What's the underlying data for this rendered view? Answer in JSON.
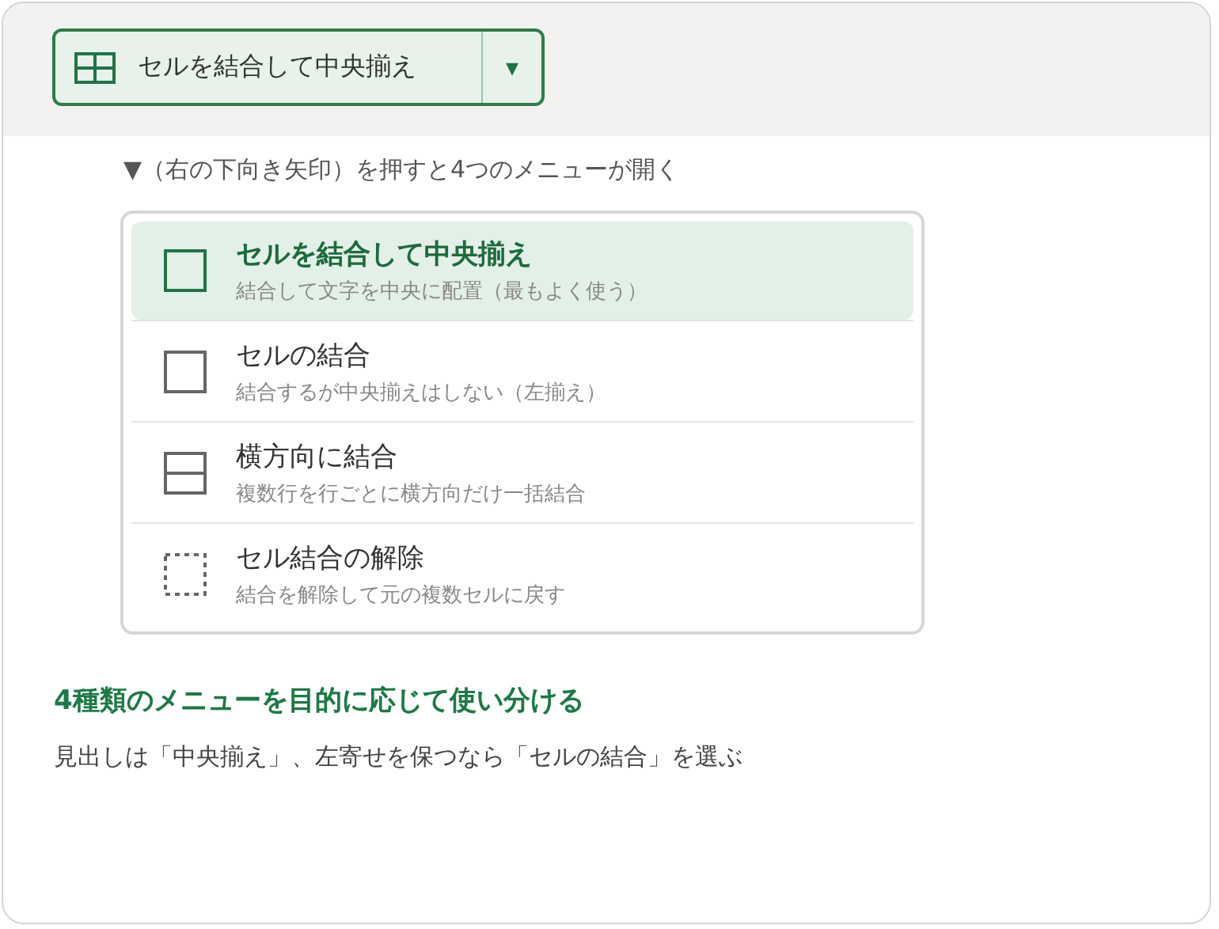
{
  "split_button": {
    "label": "セルを結合して中央揃え",
    "dropdown": "▾"
  },
  "note": "▼（右の下向き矢印）を押すと4つのメニューが開く",
  "menu": [
    {
      "kind": "merge-center",
      "title": "セルを結合して中央揃え",
      "description": "結合して文字を中央に配置（最もよく使う）",
      "selected": true
    },
    {
      "kind": "merge",
      "title": "セルの結合",
      "description": "結合するが中央揃えはしない（左揃え）",
      "selected": false
    },
    {
      "kind": "across",
      "title": "横方向に結合",
      "description": "複数行を行ごとに横方向だけ一括結合",
      "selected": false
    },
    {
      "kind": "unmerge",
      "title": "セル結合の解除",
      "description": "結合を解除して元の複数セルに戻す",
      "selected": false
    }
  ],
  "heading": "4種類のメニューを目的に応じて使い分ける",
  "body": "見出しは「中央揃え」、左寄せを保つなら「セルの結合」を選ぶ"
}
